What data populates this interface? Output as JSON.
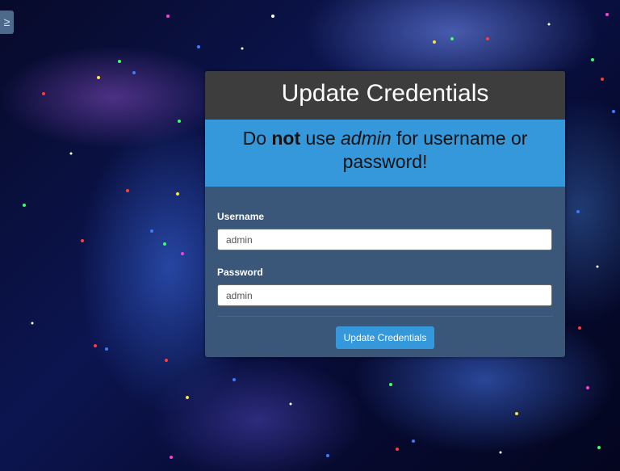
{
  "corner_button": {
    "glyph": "≥"
  },
  "panel": {
    "title": "Update Credentials",
    "warning": {
      "part1": "Do ",
      "bold": "not",
      "part2": " use ",
      "italic": "admin",
      "part3": " for username or password!"
    },
    "username": {
      "label": "Username",
      "value": "admin"
    },
    "password": {
      "label": "Password",
      "value": "admin"
    },
    "submit_label": "Update Credentials"
  },
  "colors": {
    "header_bg": "#3d3d3d",
    "warning_bg": "#3498db",
    "panel_bg": "#3a5678",
    "button_bg": "#3498db"
  }
}
